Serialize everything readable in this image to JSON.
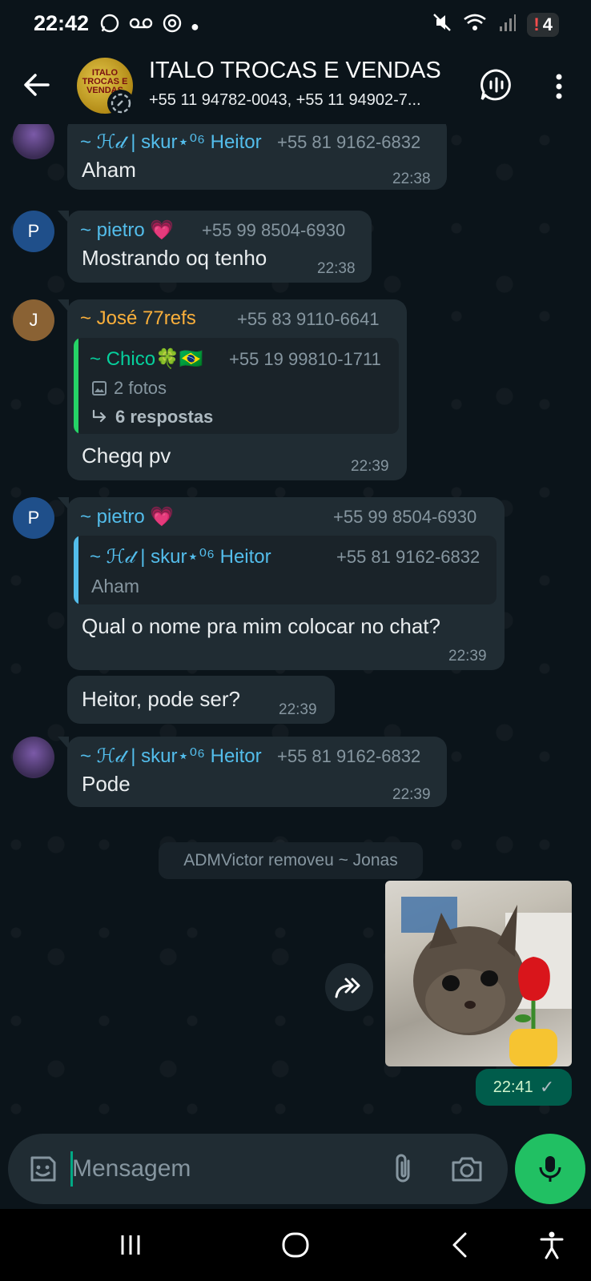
{
  "status_bar": {
    "time": "22:42",
    "battery": "4",
    "battery_warn": "!"
  },
  "header": {
    "title": "ITALO TROCAS E VENDAS",
    "subtitle": "+55 11 94782-0043, +55 11 94902-7...",
    "avatar_logo": "ITALO TROCAS E VENDAS"
  },
  "messages": [
    {
      "sender": "~ ℋ𝒹 | skur⋆⁰⁶ Heitor",
      "phone": "+55 81 9162-6832",
      "text": "Aham",
      "time": "22:38"
    },
    {
      "sender": "~ pietro 💗",
      "phone": "+55 99 8504-6930",
      "text": "Mostrando oq tenho",
      "time": "22:38",
      "avatar_letter": "P"
    },
    {
      "sender": "~ José 77refs",
      "phone": "+55 83 9110-6641",
      "quote_sender": "~ Chico🍀🇧🇷",
      "quote_phone": "+55 19 99810-1711",
      "quote_media": "2 fotos",
      "quote_replies": "6 respostas",
      "text": "Chegq pv",
      "time": "22:39",
      "avatar_letter": "J"
    },
    {
      "sender": "~ pietro 💗",
      "phone": "+55 99 8504-6930",
      "quote_sender": "~ ℋ𝒹 | skur⋆⁰⁶ Heitor",
      "quote_phone": "+55 81 9162-6832",
      "quote_text": "Aham",
      "text": "Qual o nome pra mim colocar no chat?",
      "time": "22:39",
      "avatar_letter": "P"
    },
    {
      "text": "Heitor, pode ser?",
      "time": "22:39"
    },
    {
      "sender": "~ ℋ𝒹 | skur⋆⁰⁶ Heitor",
      "phone": "+55 81 9162-6832",
      "text": "Pode",
      "time": "22:39"
    }
  ],
  "system_message": "ADMVictor removeu ~ Jonas",
  "outgoing_image": {
    "time": "22:41",
    "tick": "✓"
  },
  "input": {
    "placeholder": "Mensagem",
    "value": ""
  },
  "colors": {
    "bg": "#0b141a",
    "bubble_in": "#202c33",
    "bubble_out": "#005c4b",
    "accent": "#21c063",
    "heitor_name": "#53bdeb",
    "pietro_name": "#53bdeb",
    "jose_name": "#fbb03b",
    "chico_name": "#06cf9c",
    "quote_bar_green": "#25d366",
    "quote_bar_blue": "#53bdeb"
  }
}
